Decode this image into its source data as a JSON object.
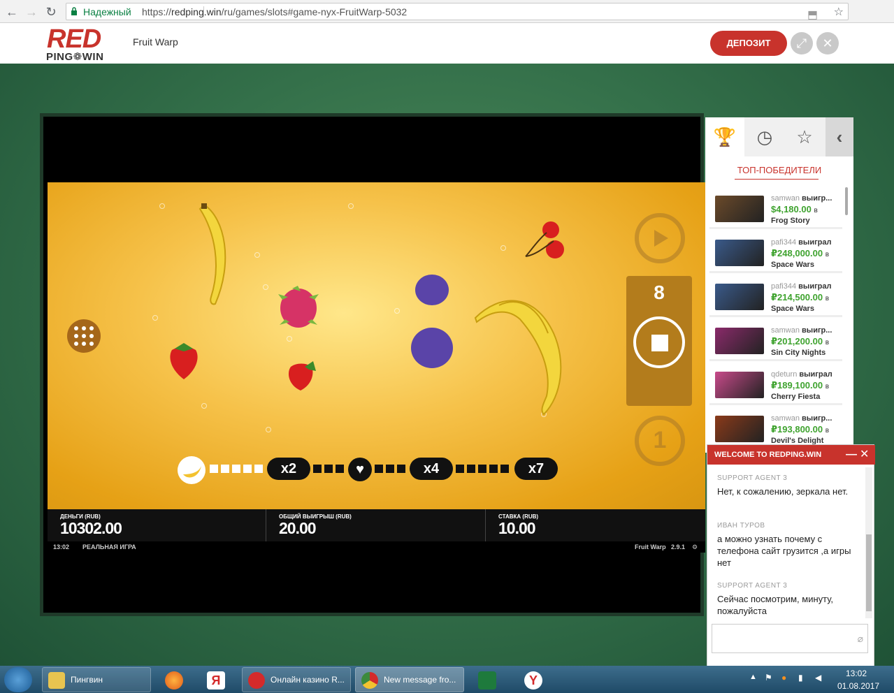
{
  "browser": {
    "secure_label": "Надежный",
    "url_scheme": "https://",
    "url_host": "redping.win",
    "url_path": "/ru/games/slots#game-nyx-FruitWarp-5032"
  },
  "site": {
    "logo_red": "RED",
    "logo_ping": "PING❁WIN",
    "game_title": "Fruit Warp",
    "deposit_label": "ДЕПОЗИТ"
  },
  "game": {
    "spins_left": "8",
    "multipliers": [
      "x2",
      "x4",
      "x7"
    ],
    "coin_label": "1",
    "money_label": "ДЕНЬГИ (RUB)",
    "money_value": "10302.00",
    "total_win_label": "ОБЩИЙ ВЫИГРЫШ (RUB)",
    "total_win_value": "20.00",
    "bet_label": "СТАВКА (RUB)",
    "bet_value": "10.00",
    "status_time": "13:02",
    "status_mode": "РЕАЛЬНАЯ ИГРА",
    "status_game": "Fruit Warp",
    "status_version": "2.9.1"
  },
  "winners_panel": {
    "title": "ТОП-ПОБЕДИТЕЛИ",
    "tabs": [
      "trophy-icon",
      "clock-icon",
      "star-icon"
    ],
    "items": [
      {
        "user": "samwan",
        "verb": "выигр...",
        "amount": "$4,180.00",
        "in": "в",
        "game": "Frog Story",
        "thumb": "#6b4a2a"
      },
      {
        "user": "pafi344",
        "verb": "выиграл",
        "amount": "₽248,000.00",
        "in": "в",
        "game": "Space Wars",
        "thumb": "#3a5a8a"
      },
      {
        "user": "pafi344",
        "verb": "выиграл",
        "amount": "₽214,500.00",
        "in": "в",
        "game": "Space Wars",
        "thumb": "#3a5a8a"
      },
      {
        "user": "samwan",
        "verb": "выигр...",
        "amount": "₽201,200.00",
        "in": "в",
        "game": "Sin City Nights",
        "thumb": "#8a2a6a"
      },
      {
        "user": "qdeturn",
        "verb": "выиграл",
        "amount": "₽189,100.00",
        "in": "в",
        "game": "Cherry Fiesta",
        "thumb": "#c84a8a"
      },
      {
        "user": "samwan",
        "verb": "выигр...",
        "amount": "₽193,800.00",
        "in": "в",
        "game": "Devil's Delight",
        "thumb": "#8a3a1a"
      }
    ]
  },
  "chat": {
    "title": "WELCOME TO REDPING.WIN",
    "minimize": "—",
    "close": "✕",
    "messages": [
      {
        "author": "SUPPORT AGENT 3",
        "text": "Нет, к сожалению, зеркала нет."
      },
      {
        "author": "ИВАН ТУРОВ",
        "text": "а можно узнать почему с телефона сайт грузится ,а игры нет"
      },
      {
        "author": "SUPPORT AGENT 3",
        "text": "Сейчас посмотрим, минуту, пожалуйста"
      }
    ]
  },
  "taskbar": {
    "tasks": [
      {
        "label": "Пингвин",
        "color": "#e8c450"
      },
      {
        "label": "Онлайн казино R...",
        "color": "#d42a2a"
      },
      {
        "label": "New message fro...",
        "color": "#3c8a3c"
      }
    ],
    "time": "13:02",
    "date": "01.08.2017"
  }
}
